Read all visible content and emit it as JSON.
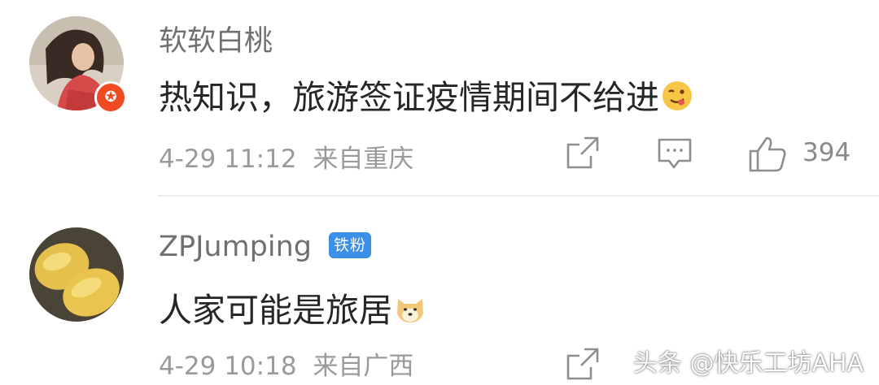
{
  "comments": [
    {
      "username": "软软白桃",
      "text": "热知识，旅游签证疫情期间不给进",
      "emoji_icon": "drooling-face-emoji",
      "time": "4-29 11:12",
      "location": "来自重庆",
      "likes": "394"
    },
    {
      "username": "ZPJumping",
      "tag": "铁粉",
      "text": "人家可能是旅居",
      "emoji_icon": "doge-emoji",
      "time": "4-29 10:18",
      "location": "来自广西"
    }
  ],
  "watermark": "头条 @快乐工坊AHA",
  "colors": {
    "vip_badge": "#f04a23",
    "tag": "#3c8fe6",
    "meta": "#9a9a9a"
  }
}
